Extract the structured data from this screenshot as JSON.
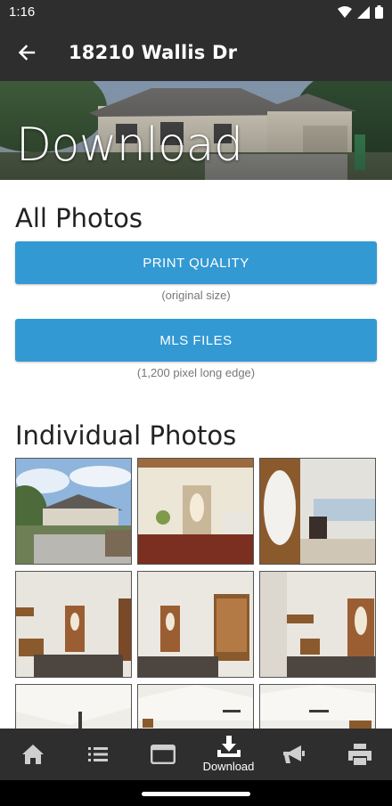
{
  "status_bar": {
    "time": "1:16"
  },
  "app_bar": {
    "title": "18210 Wallis Dr"
  },
  "hero": {
    "title": "Download"
  },
  "all_photos": {
    "heading": "All Photos",
    "print_button": "PRINT QUALITY",
    "print_caption": "(original size)",
    "mls_button": "MLS FILES",
    "mls_caption": "(1,200 pixel long edge)"
  },
  "individual_photos": {
    "heading": "Individual Photos",
    "thumbnails": [
      "house-exterior",
      "entry-hall",
      "living-room-door",
      "foyer-1",
      "foyer-2",
      "foyer-3",
      "living-room-ceiling-1",
      "living-room-ceiling-2",
      "living-room-ceiling-3"
    ]
  },
  "bottom_nav": {
    "items": [
      {
        "icon": "home-icon",
        "label": ""
      },
      {
        "icon": "list-icon",
        "label": ""
      },
      {
        "icon": "browser-icon",
        "label": ""
      },
      {
        "icon": "download-icon",
        "label": "Download"
      },
      {
        "icon": "megaphone-icon",
        "label": ""
      },
      {
        "icon": "printer-icon",
        "label": ""
      }
    ]
  },
  "colors": {
    "accent": "#3399d3",
    "bar": "#2e2e2e"
  }
}
